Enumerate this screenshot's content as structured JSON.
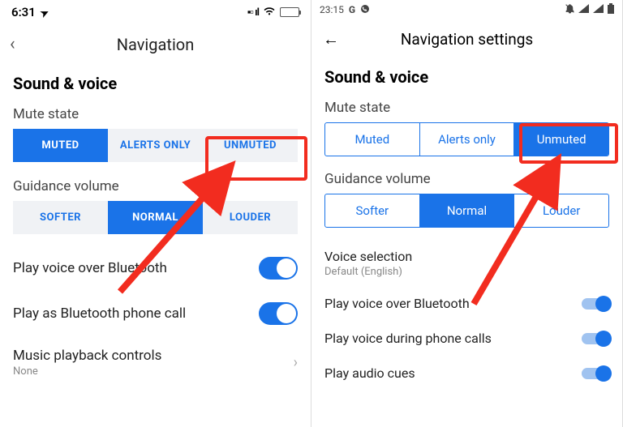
{
  "ios": {
    "status": {
      "time": "6:31",
      "loc_icon": "➤",
      "sig_icon": "ıı",
      "wifi_icon": "wifi"
    },
    "header": {
      "back": "‹",
      "title": "Navigation"
    },
    "section": "Sound & voice",
    "mute_label": "Mute state",
    "mute_options": [
      "MUTED",
      "ALERTS ONLY",
      "UNMUTED"
    ],
    "mute_selected": 0,
    "guidance_label": "Guidance volume",
    "guidance_options": [
      "SOFTER",
      "NORMAL",
      "LOUDER"
    ],
    "guidance_selected": 1,
    "toggles": [
      {
        "label": "Play voice over Bluetooth",
        "on": true
      },
      {
        "label": "Play as Bluetooth phone call",
        "on": true
      }
    ],
    "music_label": "Music playback controls",
    "music_value": "None"
  },
  "android": {
    "status": {
      "time": "23:15",
      "g_icon": "G",
      "phone_icon": "✆",
      "mute_icon": "🔕",
      "sig_icon": "▾▴",
      "bat_icon": "▮"
    },
    "header": {
      "back": "←",
      "title": "Navigation settings"
    },
    "section": "Sound & voice",
    "mute_label": "Mute state",
    "mute_options": [
      "Muted",
      "Alerts only",
      "Unmuted"
    ],
    "mute_selected": 2,
    "guidance_label": "Guidance volume",
    "guidance_options": [
      "Softer",
      "Normal",
      "Louder"
    ],
    "guidance_selected": 1,
    "voice_sel_label": "Voice selection",
    "voice_sel_value": "Default (English)",
    "toggles": [
      {
        "label": "Play voice over Bluetooth",
        "on": true
      },
      {
        "label": "Play voice during phone calls",
        "on": true
      },
      {
        "label": "Play audio cues",
        "on": true
      }
    ]
  }
}
